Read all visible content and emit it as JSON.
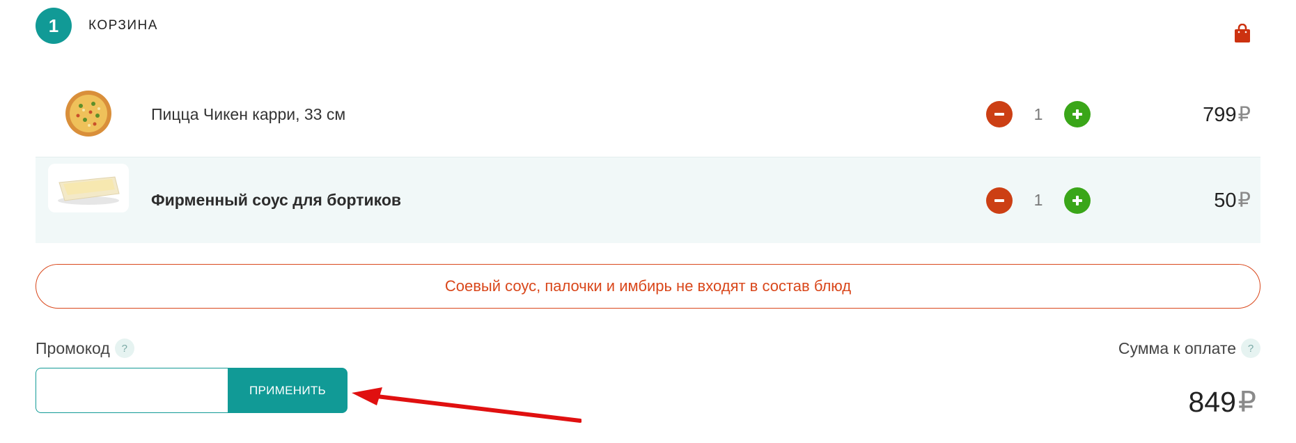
{
  "step": {
    "number": "1",
    "title": "КОРЗИНА"
  },
  "cart_items": [
    {
      "name": "Пицца Чикен карри, 33 см",
      "qty": "1",
      "price": "799",
      "currency": "₽"
    },
    {
      "name": "Фирменный соус для бортиков",
      "qty": "1",
      "price": "50",
      "currency": "₽"
    }
  ],
  "notice": "Соевый соус, палочки и имбирь не входят в состав блюд",
  "promo": {
    "label": "Промокод",
    "help": "?",
    "value": "",
    "button": "ПРИМЕНИТЬ"
  },
  "total": {
    "label": "Сумма к оплате",
    "help": "?",
    "value": "849",
    "currency": "₽"
  },
  "colors": {
    "accent": "#119a96",
    "minus": "#cc3f14",
    "plus": "#3aa619",
    "notice": "#d9471b",
    "annotation_arrow": "#e01010"
  },
  "icons": [
    "shopping-bag-icon",
    "minus-icon",
    "plus-icon",
    "help-icon"
  ]
}
